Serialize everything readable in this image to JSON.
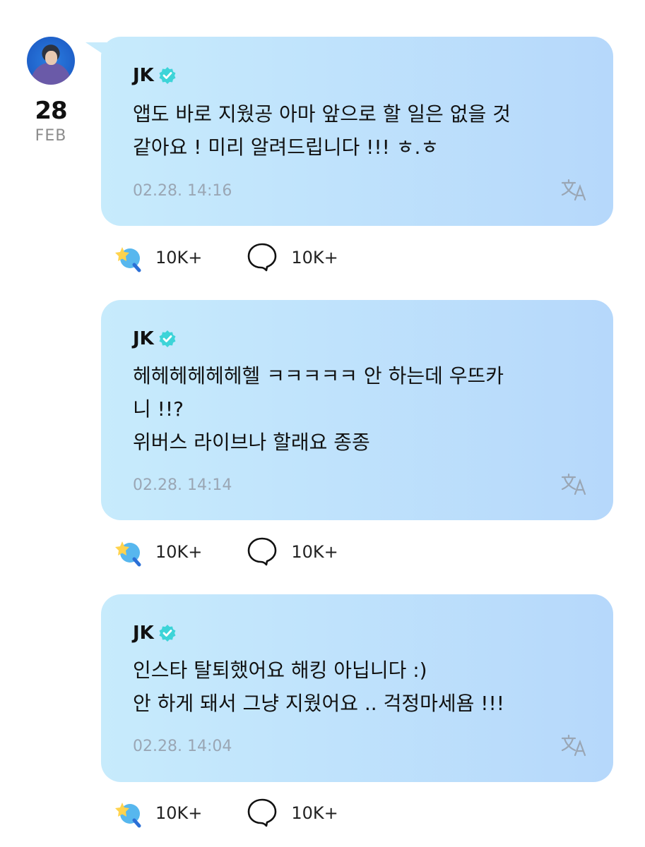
{
  "date": {
    "day": "28",
    "month": "FEB"
  },
  "posts": [
    {
      "author": "JK",
      "lines": [
        "앱도 바로 지웠공 아마 앞으로 할 일은 없을 것",
        "같아요 ! 미리 알려드립니다 !!! ㅎ.ㅎ"
      ],
      "time": "02.28. 14:16",
      "reactions": "10K+",
      "comments": "10K+"
    },
    {
      "author": "JK",
      "lines": [
        "헤헤헤헤헤헤헬 ㅋㅋㅋㅋㅋ 안 하는데 우뜨카",
        "니 !!?",
        "위버스 라이브나 할래요 종종"
      ],
      "time": "02.28. 14:14",
      "reactions": "10K+",
      "comments": "10K+"
    },
    {
      "author": "JK",
      "lines": [
        "인스타 탈퇴했어요 해킹 아닙니다 :)",
        "안 하게 돼서 그냥 지웠어요 .. 걱정마세욤 !!!"
      ],
      "time": "02.28. 14:04",
      "reactions": "10K+",
      "comments": "10K+"
    }
  ],
  "icons": {
    "verified": "verified-badge-icon",
    "translate": "translate-icon",
    "reaction": "reaction-icon",
    "comment": "comment-icon"
  },
  "colors": {
    "bubble_left": "#c7ebfc",
    "bubble_right": "#b6d8fb",
    "verified": "#3dd4d8"
  }
}
